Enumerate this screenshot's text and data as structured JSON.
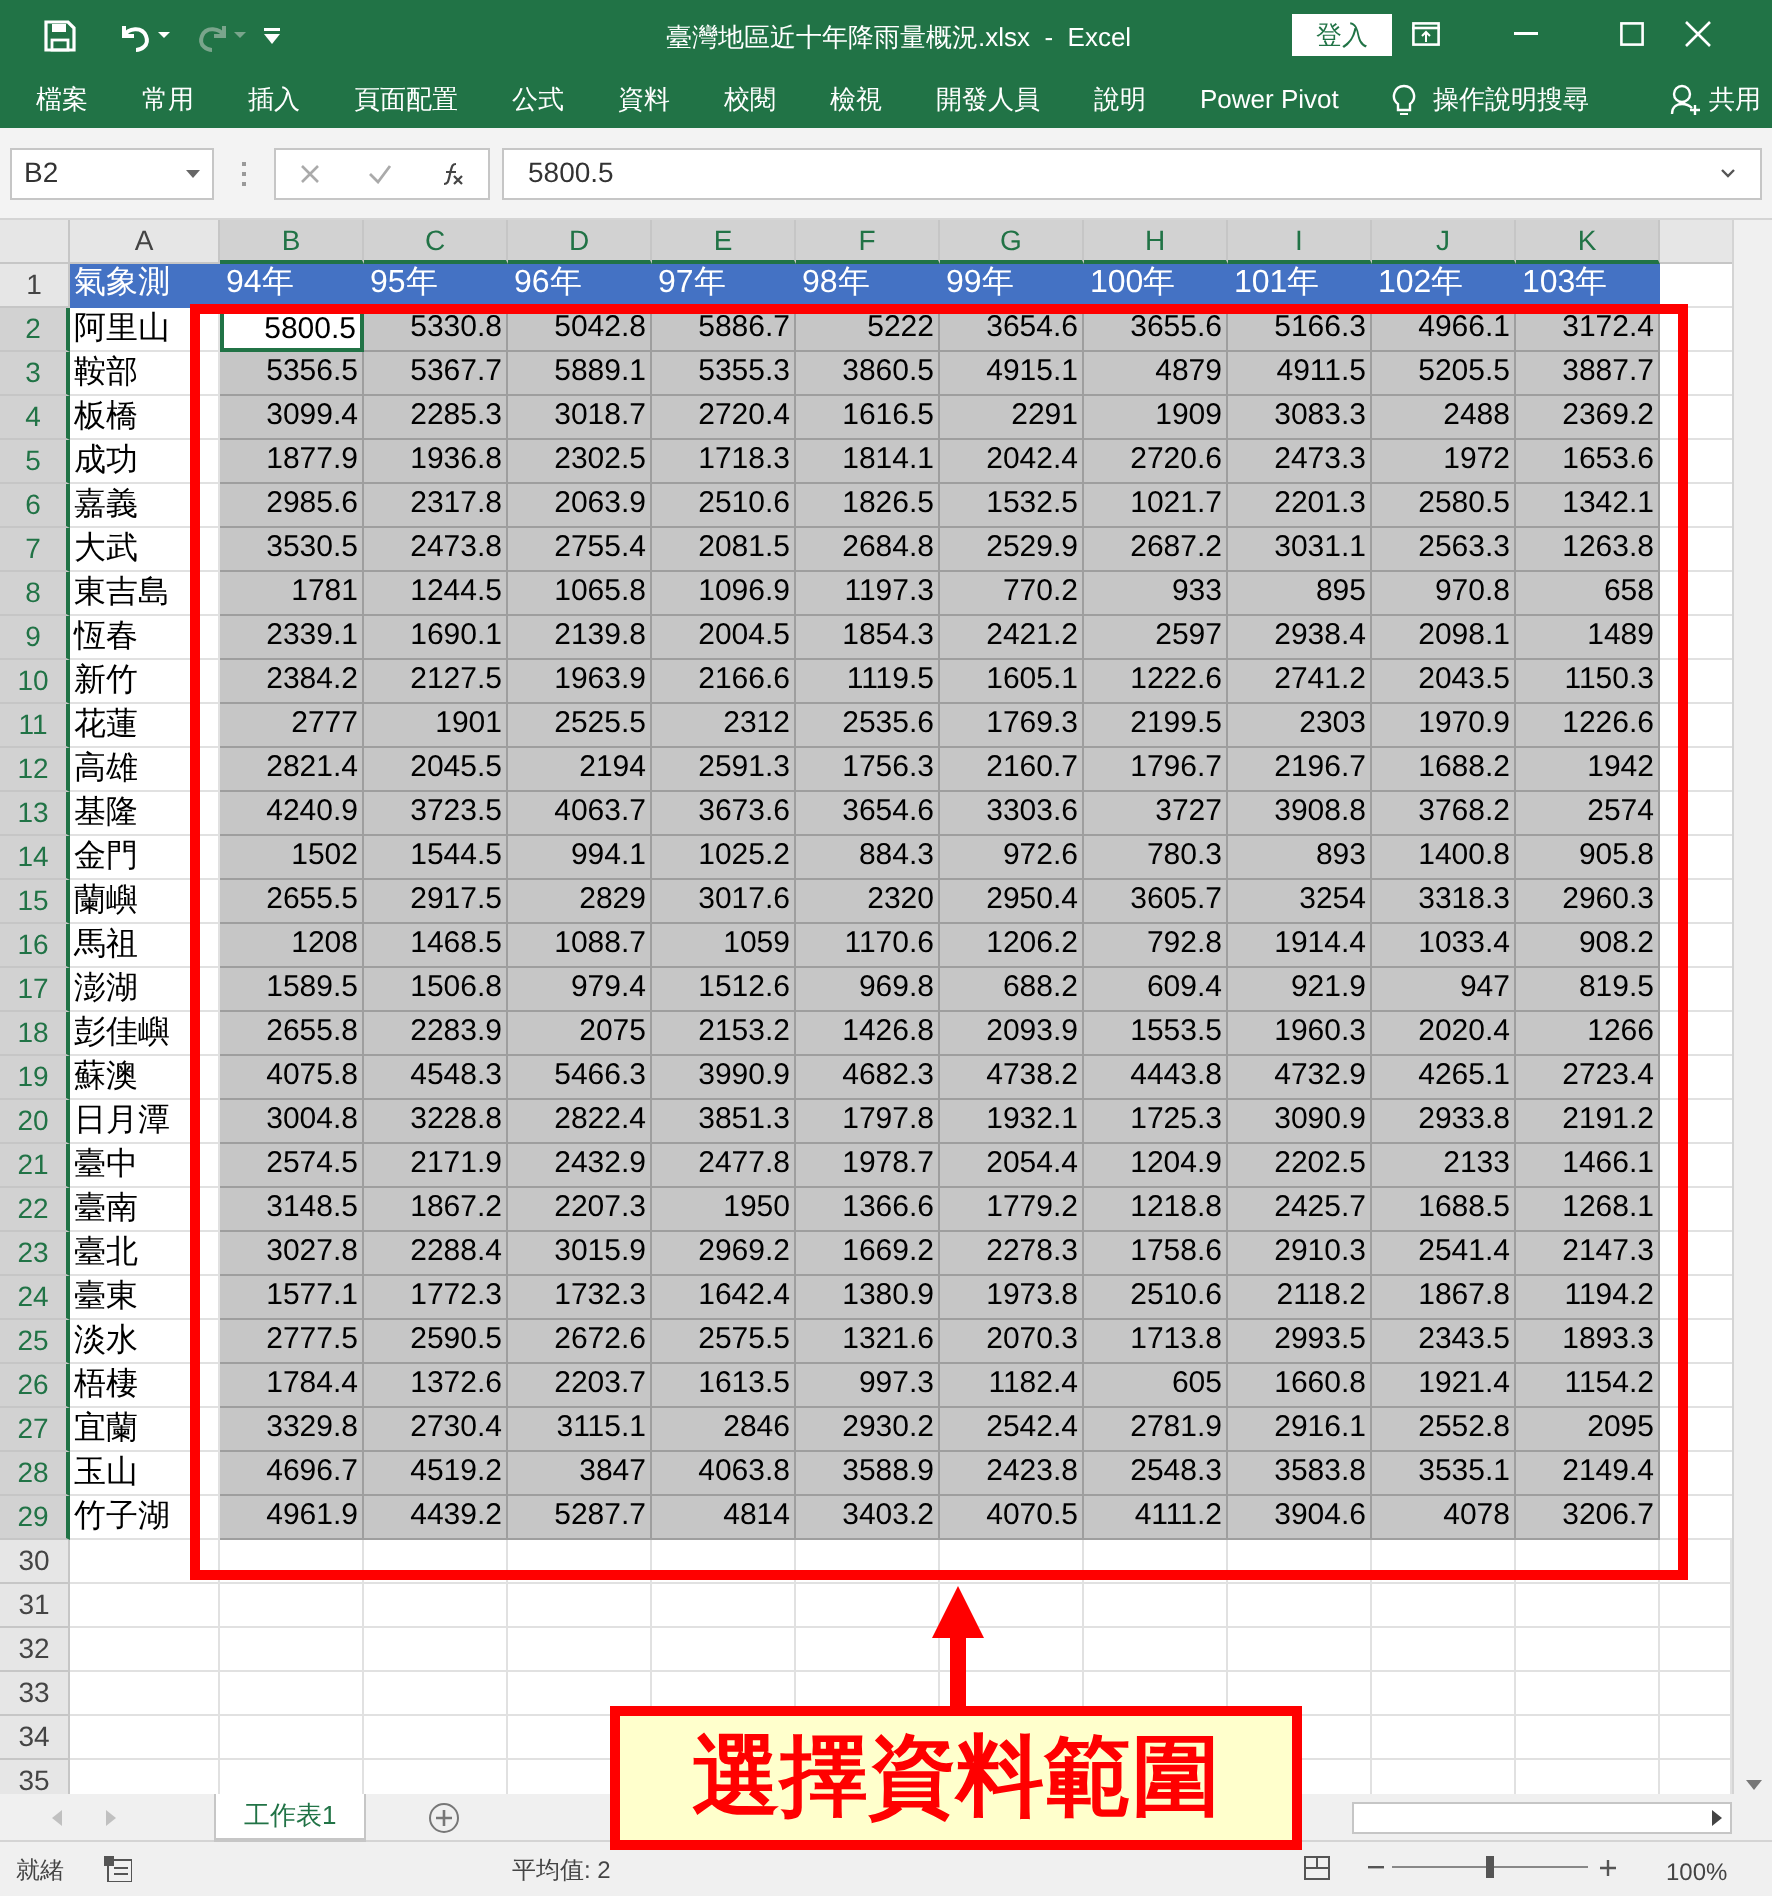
{
  "window": {
    "title": "臺灣地區近十年降雨量概況.xlsx  -  Excel",
    "sign_in": "登入"
  },
  "ribbon_tabs": [
    "檔案",
    "常用",
    "插入",
    "頁面配置",
    "公式",
    "資料",
    "校閱",
    "檢視",
    "開發人員",
    "說明",
    "Power Pivot"
  ],
  "tell_me": "操作說明搜尋",
  "share": "共用",
  "name_box": "B2",
  "formula": "5800.5",
  "columns": [
    {
      "label": "A",
      "selected": false
    },
    {
      "label": "B",
      "selected": true
    },
    {
      "label": "C",
      "selected": true
    },
    {
      "label": "D",
      "selected": true
    },
    {
      "label": "E",
      "selected": true
    },
    {
      "label": "F",
      "selected": true
    },
    {
      "label": "G",
      "selected": true
    },
    {
      "label": "H",
      "selected": true
    },
    {
      "label": "I",
      "selected": true
    },
    {
      "label": "J",
      "selected": true
    },
    {
      "label": "K",
      "selected": true
    }
  ],
  "header_row": {
    "number": "1",
    "cells": [
      "氣象測",
      "94年",
      "95年",
      "96年",
      "97年",
      "98年",
      "99年",
      "100年",
      "101年",
      "102年",
      "103年"
    ]
  },
  "rows": [
    {
      "number": "2",
      "station": "阿里山",
      "values": [
        "5800.5",
        "5330.8",
        "5042.8",
        "5886.7",
        "5222",
        "3654.6",
        "3655.6",
        "5166.3",
        "4966.1",
        "3172.4"
      ]
    },
    {
      "number": "3",
      "station": "鞍部",
      "values": [
        "5356.5",
        "5367.7",
        "5889.1",
        "5355.3",
        "3860.5",
        "4915.1",
        "4879",
        "4911.5",
        "5205.5",
        "3887.7"
      ]
    },
    {
      "number": "4",
      "station": "板橋",
      "values": [
        "3099.4",
        "2285.3",
        "3018.7",
        "2720.4",
        "1616.5",
        "2291",
        "1909",
        "3083.3",
        "2488",
        "2369.2"
      ]
    },
    {
      "number": "5",
      "station": "成功",
      "values": [
        "1877.9",
        "1936.8",
        "2302.5",
        "1718.3",
        "1814.1",
        "2042.4",
        "2720.6",
        "2473.3",
        "1972",
        "1653.6"
      ]
    },
    {
      "number": "6",
      "station": "嘉義",
      "values": [
        "2985.6",
        "2317.8",
        "2063.9",
        "2510.6",
        "1826.5",
        "1532.5",
        "1021.7",
        "2201.3",
        "2580.5",
        "1342.1"
      ]
    },
    {
      "number": "7",
      "station": "大武",
      "values": [
        "3530.5",
        "2473.8",
        "2755.4",
        "2081.5",
        "2684.8",
        "2529.9",
        "2687.2",
        "3031.1",
        "2563.3",
        "1263.8"
      ]
    },
    {
      "number": "8",
      "station": "東吉島",
      "values": [
        "1781",
        "1244.5",
        "1065.8",
        "1096.9",
        "1197.3",
        "770.2",
        "933",
        "895",
        "970.8",
        "658"
      ]
    },
    {
      "number": "9",
      "station": "恆春",
      "values": [
        "2339.1",
        "1690.1",
        "2139.8",
        "2004.5",
        "1854.3",
        "2421.2",
        "2597",
        "2938.4",
        "2098.1",
        "1489"
      ]
    },
    {
      "number": "10",
      "station": "新竹",
      "values": [
        "2384.2",
        "2127.5",
        "1963.9",
        "2166.6",
        "1119.5",
        "1605.1",
        "1222.6",
        "2741.2",
        "2043.5",
        "1150.3"
      ]
    },
    {
      "number": "11",
      "station": "花蓮",
      "values": [
        "2777",
        "1901",
        "2525.5",
        "2312",
        "2535.6",
        "1769.3",
        "2199.5",
        "2303",
        "1970.9",
        "1226.6"
      ]
    },
    {
      "number": "12",
      "station": "高雄",
      "values": [
        "2821.4",
        "2045.5",
        "2194",
        "2591.3",
        "1756.3",
        "2160.7",
        "1796.7",
        "2196.7",
        "1688.2",
        "1942"
      ]
    },
    {
      "number": "13",
      "station": "基隆",
      "values": [
        "4240.9",
        "3723.5",
        "4063.7",
        "3673.6",
        "3654.6",
        "3303.6",
        "3727",
        "3908.8",
        "3768.2",
        "2574"
      ]
    },
    {
      "number": "14",
      "station": "金門",
      "values": [
        "1502",
        "1544.5",
        "994.1",
        "1025.2",
        "884.3",
        "972.6",
        "780.3",
        "893",
        "1400.8",
        "905.8"
      ]
    },
    {
      "number": "15",
      "station": "蘭嶼",
      "values": [
        "2655.5",
        "2917.5",
        "2829",
        "3017.6",
        "2320",
        "2950.4",
        "3605.7",
        "3254",
        "3318.3",
        "2960.3"
      ]
    },
    {
      "number": "16",
      "station": "馬祖",
      "values": [
        "1208",
        "1468.5",
        "1088.7",
        "1059",
        "1170.6",
        "1206.2",
        "792.8",
        "1914.4",
        "1033.4",
        "908.2"
      ]
    },
    {
      "number": "17",
      "station": "澎湖",
      "values": [
        "1589.5",
        "1506.8",
        "979.4",
        "1512.6",
        "969.8",
        "688.2",
        "609.4",
        "921.9",
        "947",
        "819.5"
      ]
    },
    {
      "number": "18",
      "station": "彭佳嶼",
      "values": [
        "2655.8",
        "2283.9",
        "2075",
        "2153.2",
        "1426.8",
        "2093.9",
        "1553.5",
        "1960.3",
        "2020.4",
        "1266"
      ]
    },
    {
      "number": "19",
      "station": "蘇澳",
      "values": [
        "4075.8",
        "4548.3",
        "5466.3",
        "3990.9",
        "4682.3",
        "4738.2",
        "4443.8",
        "4732.9",
        "4265.1",
        "2723.4"
      ]
    },
    {
      "number": "20",
      "station": "日月潭",
      "values": [
        "3004.8",
        "3228.8",
        "2822.4",
        "3851.3",
        "1797.8",
        "1932.1",
        "1725.3",
        "3090.9",
        "2933.8",
        "2191.2"
      ]
    },
    {
      "number": "21",
      "station": "臺中",
      "values": [
        "2574.5",
        "2171.9",
        "2432.9",
        "2477.8",
        "1978.7",
        "2054.4",
        "1204.9",
        "2202.5",
        "2133",
        "1466.1"
      ]
    },
    {
      "number": "22",
      "station": "臺南",
      "values": [
        "3148.5",
        "1867.2",
        "2207.3",
        "1950",
        "1366.6",
        "1779.2",
        "1218.8",
        "2425.7",
        "1688.5",
        "1268.1"
      ]
    },
    {
      "number": "23",
      "station": "臺北",
      "values": [
        "3027.8",
        "2288.4",
        "3015.9",
        "2969.2",
        "1669.2",
        "2278.3",
        "1758.6",
        "2910.3",
        "2541.4",
        "2147.3"
      ]
    },
    {
      "number": "24",
      "station": "臺東",
      "values": [
        "1577.1",
        "1772.3",
        "1732.3",
        "1642.4",
        "1380.9",
        "1973.8",
        "2510.6",
        "2118.2",
        "1867.8",
        "1194.2"
      ]
    },
    {
      "number": "25",
      "station": "淡水",
      "values": [
        "2777.5",
        "2590.5",
        "2672.6",
        "2575.5",
        "1321.6",
        "2070.3",
        "1713.8",
        "2993.5",
        "2343.5",
        "1893.3"
      ]
    },
    {
      "number": "26",
      "station": "梧棲",
      "values": [
        "1784.4",
        "1372.6",
        "2203.7",
        "1613.5",
        "997.3",
        "1182.4",
        "605",
        "1660.8",
        "1921.4",
        "1154.2"
      ]
    },
    {
      "number": "27",
      "station": "宜蘭",
      "values": [
        "3329.8",
        "2730.4",
        "3115.1",
        "2846",
        "2930.2",
        "2542.4",
        "2781.9",
        "2916.1",
        "2552.8",
        "2095"
      ]
    },
    {
      "number": "28",
      "station": "玉山",
      "values": [
        "4696.7",
        "4519.2",
        "3847",
        "4063.8",
        "3588.9",
        "2423.8",
        "2548.3",
        "3583.8",
        "3535.1",
        "2149.4"
      ]
    },
    {
      "number": "29",
      "station": "竹子湖",
      "values": [
        "4961.9",
        "4439.2",
        "5287.7",
        "4814",
        "3403.2",
        "4070.5",
        "4111.2",
        "3904.6",
        "4078",
        "3206.7"
      ]
    }
  ],
  "empty_rows": [
    "30",
    "31",
    "32",
    "33",
    "34",
    "35"
  ],
  "sheet_tabs": [
    {
      "label": "工作表1",
      "selected": true
    }
  ],
  "status": {
    "mode": "就緒",
    "summary": "平均值: 2",
    "zoom": "100%",
    "zoom_slider": {
      "level": 0.5
    }
  },
  "callout": {
    "text": "選擇資料範圍"
  }
}
